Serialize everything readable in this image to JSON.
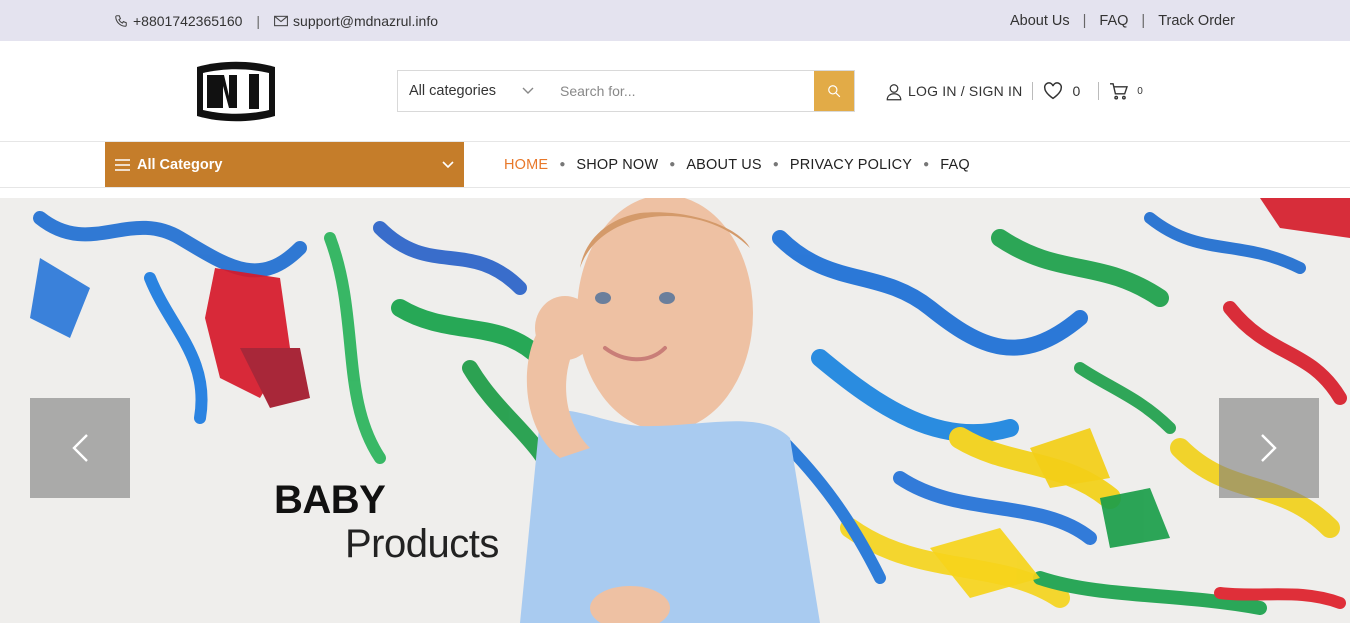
{
  "topbar": {
    "phone": "+8801742365160",
    "email": "support@mdnazrul.info",
    "links": [
      "About Us",
      "FAQ",
      "Track Order"
    ]
  },
  "header": {
    "logo_text": "NI",
    "search": {
      "category": "All categories",
      "placeholder": "Search for..."
    },
    "login_label": "LOG IN / SIGN IN",
    "wishlist_count": "0",
    "cart_count": "0"
  },
  "nav": {
    "all_category": "All Category",
    "items": [
      "HOME",
      "SHOP NOW",
      "ABOUT US",
      "PRIVACY POLICY",
      "FAQ"
    ],
    "active": "HOME"
  },
  "hero": {
    "title": "BABY",
    "subtitle": "Products"
  },
  "colors": {
    "topbar_bg": "#e4e3ef",
    "accent_orange": "#c57d2a",
    "search_button": "#e2ab47",
    "active_nav": "#e8782a"
  }
}
